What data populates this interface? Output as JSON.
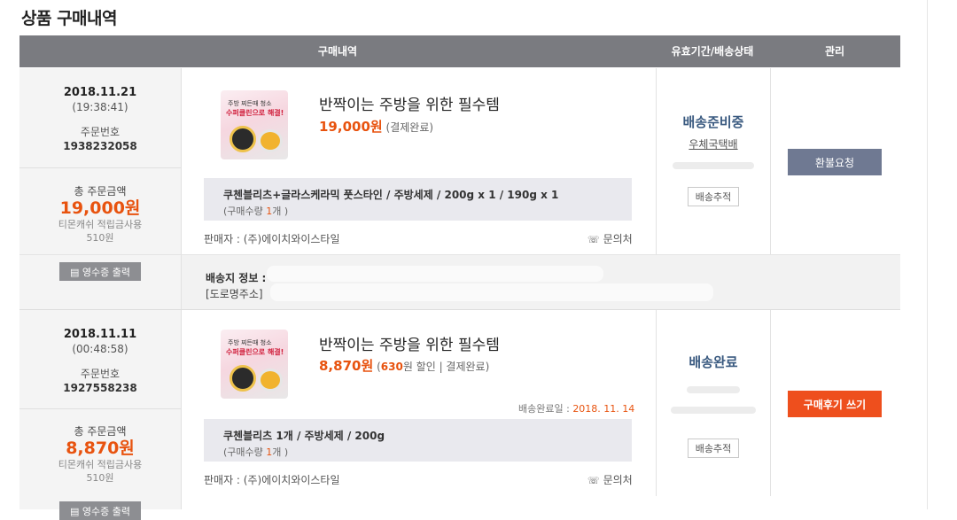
{
  "page": {
    "title": "상품 구매내역"
  },
  "table_header": {
    "purchase": "구매내역",
    "status": "유효기간/배송상태",
    "manage": "관리"
  },
  "orders": [
    {
      "date": "2018.11.21",
      "time": "(19:38:41)",
      "order_label": "주문번호",
      "order_number": "1938232058",
      "total_label": "총 주문금액",
      "total": "19,000원",
      "cash_label": "티몬캐쉬 적립금사용",
      "cash_value": "510원",
      "receipt_label": "영수증 출력",
      "product": {
        "name": "반짝이는 주방을 위한 필수템",
        "price": "19,000원",
        "payment_status": "(결제완료)",
        "thumb_line1": "주방 찌든때 청소",
        "thumb_line2": "수퍼클린으로 해결!"
      },
      "option": {
        "name": "쿠첸블리츠+글라스케라믹 풋스타인 / 주방세제 / 200g x 1 / 190g x 1",
        "qty_prefix": "(구매수량 ",
        "qty": "1",
        "qty_suffix": "개 )"
      },
      "seller": "판매자 : (주)에이치와이스타일",
      "contact": "문의처",
      "delivery_state": "배송준비중",
      "carrier": "우체국택배",
      "track_label": "배송추적",
      "action_label": "환불요청",
      "ship_info_label": "배송지 정보 :",
      "road_address_label": "[도로명주소]"
    },
    {
      "date": "2018.11.11",
      "time": "(00:48:58)",
      "order_label": "주문번호",
      "order_number": "1927558238",
      "total_label": "총 주문금액",
      "total": "8,870원",
      "cash_label": "티몬캐쉬 적립금사용",
      "cash_value": "510원",
      "receipt_label": "영수증 출력",
      "product": {
        "name": "반짝이는 주방을 위한 필수템",
        "price": "8,870원",
        "discount_open": "(",
        "discount": "630",
        "discount_rest": "원 할인 | 결제완료)",
        "thumb_line1": "주방 찌든때 청소",
        "thumb_line2": "수퍼클린으로 해결!"
      },
      "option": {
        "name": "쿠첸블리츠 1개 / 주방세제 / 200g",
        "qty_prefix": "(구매수량 ",
        "qty": "1",
        "qty_suffix": "개 )"
      },
      "seller": "판매자 : (주)에이치와이스타일",
      "contact": "문의처",
      "ship_complete_label": "배송완료일 : ",
      "ship_complete_date": "2018. 11. 14",
      "delivery_state": "배송완료",
      "track_label": "배송추적",
      "action_label": "구매후기 쓰기"
    }
  ]
}
